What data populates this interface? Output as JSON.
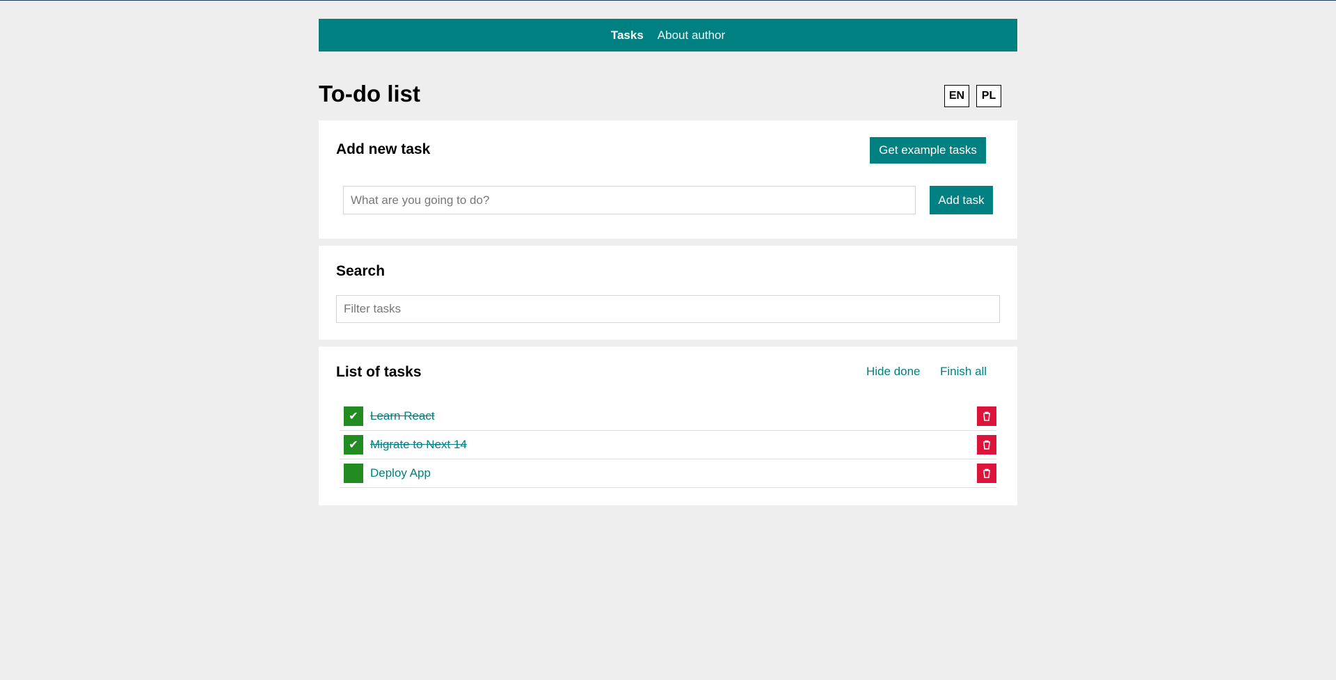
{
  "nav": {
    "tasks_label": "Tasks",
    "about_label": "About author"
  },
  "page": {
    "title": "To-do list",
    "lang_en": "EN",
    "lang_pl": "PL"
  },
  "add_section": {
    "heading": "Add new task",
    "example_button": "Get example tasks",
    "input_placeholder": "What are you going to do?",
    "add_button": "Add task"
  },
  "search_section": {
    "heading": "Search",
    "input_placeholder": "Filter tasks"
  },
  "list_section": {
    "heading": "List of tasks",
    "hide_done": "Hide done",
    "finish_all": "Finish all",
    "tasks": [
      {
        "label": "Learn React",
        "done": true
      },
      {
        "label": "Migrate to Next 14",
        "done": true
      },
      {
        "label": "Deploy App",
        "done": false
      }
    ]
  },
  "icons": {
    "check": "check-icon",
    "delete": "trash-icon"
  },
  "colors": {
    "primary": "#008080",
    "done": "#228b22",
    "delete": "#dc143c",
    "background": "#eeeeee"
  }
}
